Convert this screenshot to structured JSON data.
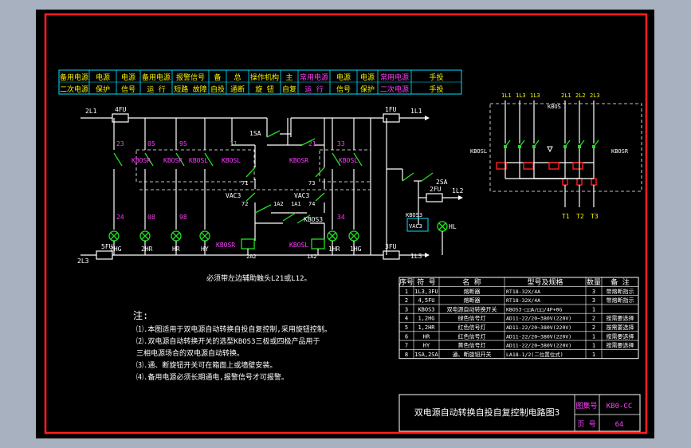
{
  "header_groups": [
    {
      "top": "备用电源",
      "bottom": "二次电源"
    },
    {
      "top": "电源",
      "bottom": "保护"
    },
    {
      "top": "电源",
      "bottom": "信号"
    },
    {
      "top": "备用电源",
      "bottom": "运 行"
    },
    {
      "top": "报警信号",
      "bottom": "短路 故障"
    },
    {
      "top": "备",
      "bottom": "自投"
    },
    {
      "top": "总",
      "bottom": "通断"
    },
    {
      "top": "操作机构",
      "bottom": "旋 钮"
    },
    {
      "top": "主",
      "bottom": "自复"
    },
    {
      "top": "常用电源",
      "bottom": "运 行"
    },
    {
      "top": "电源",
      "bottom": "信号"
    },
    {
      "top": "电源",
      "bottom": "保护"
    },
    {
      "top": "常用电源",
      "bottom": "二次电源"
    },
    {
      "top": "手投",
      "bottom": "手投"
    }
  ],
  "left_circuit": {
    "supply_top_left": "2L1",
    "fuse_top_left": "4FU",
    "supply_top_right": "1L1",
    "fuse_top_right": "1FU",
    "supply_bottom_left": "2L3",
    "fuse_bottom_left": "5FU",
    "supply_bottom_right": "1L3",
    "fuse_bottom_right": "3FU",
    "node_labels_top": [
      "23",
      "05",
      "95",
      "11",
      "21",
      "33"
    ],
    "node_labels_bottom": [
      "24",
      "08",
      "98",
      "34"
    ],
    "contact_labels": [
      "KBOSR",
      "KBOSR",
      "KBOSL",
      "KBOSL",
      "KBOSR",
      "KBOSL"
    ],
    "switch_label": "1SA",
    "vac_left": "VAC3",
    "vac_right": "VAC3",
    "mid_nodes": [
      "71",
      "72",
      "73",
      "74",
      "1A2",
      "1A1",
      "2A2"
    ],
    "kbos3_label": "KBOS3",
    "lamp_labels": [
      "2HG",
      "2HR",
      "HR",
      "HY",
      "1HR",
      "1HG"
    ],
    "coil_left": "KBOSR",
    "coil_right": "KBOSL",
    "coil_nodes": [
      "2A2",
      "1A2"
    ],
    "sa2_label": "2SA",
    "fuse2_label": "2FU",
    "l12_label": "1L2",
    "kbos3_small": "KBOS3",
    "vac3_box": "VAC3",
    "hl_label": "HL",
    "note_line": "必须带左边辅助触头L21或L12。"
  },
  "right_diagram": {
    "top_left_labels": [
      "1L1",
      "1L3",
      "1L3"
    ],
    "top_right_labels": [
      "2L1",
      "2L2",
      "2L3"
    ],
    "kbos_label": "KBOS",
    "left_label": "KBOSL",
    "right_label": "KBOSR",
    "outputs": [
      "T1",
      "T2",
      "T3"
    ]
  },
  "notes": {
    "heading": "注:",
    "items": [
      "⑴.本图适用于双电源自动转换自投自复控制,采用旋钮控制。",
      "⑵.双电源自动转换开关的选型KBOS3三极或四极产品用于",
      "   三相电源场合的双电源自动转换。",
      "⑶.通、断旋钮开关可在箱面上或墙壁安装。",
      "⑷.备用电源必须长期通电,报警信号才可报警。"
    ]
  },
  "parts_table": {
    "headers": [
      "序号",
      "符 号",
      "名 称",
      "型号及规格",
      "数量",
      "备 注"
    ],
    "rows": [
      [
        "1",
        "1L3,3FU",
        "熔断器",
        "RT18-32X/4A",
        "3",
        "带熔断指示"
      ],
      [
        "2",
        "4,5FU",
        "熔断器",
        "RT18-32X/4A",
        "3",
        "带熔断指示"
      ],
      [
        "3",
        "KBOS3",
        "双电源自动转换开关",
        "KBOS3-□□A/□□/4P+0G",
        "1",
        ""
      ],
      [
        "4",
        "1,2HG",
        "绿色信号灯",
        "AD11-22/20~380V(220V)",
        "2",
        "按需要选择"
      ],
      [
        "5",
        "1,2HR",
        "红色信号灯",
        "AD11-22/20~380V(220V)",
        "2",
        "按需要选择"
      ],
      [
        "6",
        "HR",
        "红色信号灯",
        "AD11-22/20~380V(220V)",
        "1",
        "按需要选择"
      ],
      [
        "7",
        "HY",
        "黄色信号灯",
        "AD11-22/20~380V(220V)",
        "1",
        "按需要选择"
      ],
      [
        "8",
        "1SA,2SA",
        "通、断旋钮开关",
        "LA18-1/2(二位置位式)",
        "1",
        ""
      ]
    ]
  },
  "title_block": {
    "title": "双电源自动转换自投自复控制电路图3",
    "atlas_label": "图集号",
    "atlas_value": "KB0-CC",
    "page_label": "页 号",
    "page_value": "64"
  }
}
